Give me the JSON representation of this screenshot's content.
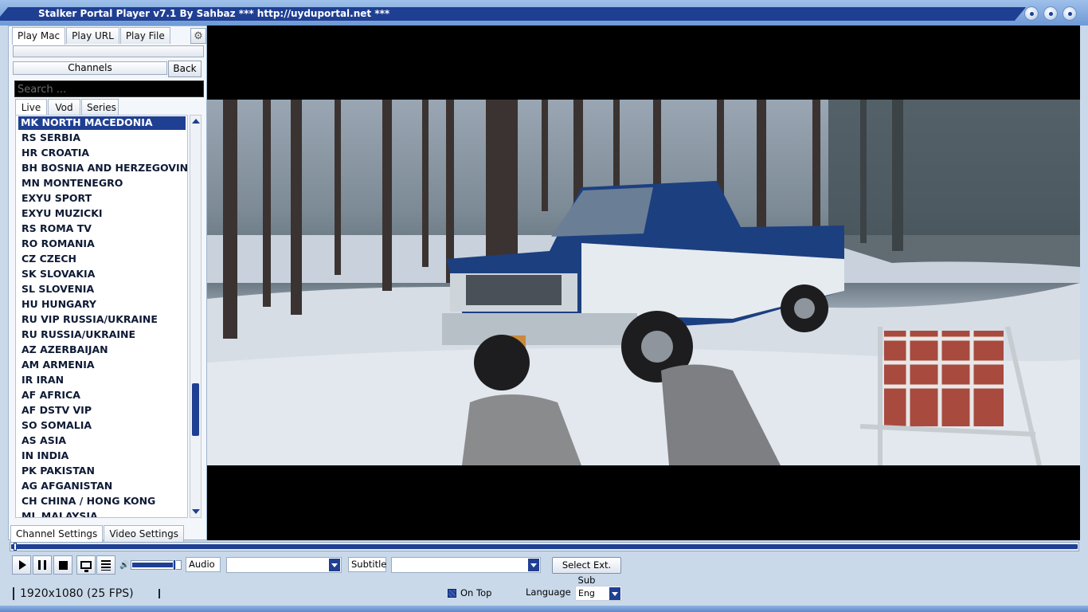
{
  "window": {
    "title": "Stalker Portal Player v7.1 By Sahbaz  *** http://uyduportal.net ***"
  },
  "left_panel": {
    "top_tabs": [
      "Play Mac",
      "Play URL",
      "Play File"
    ],
    "channels_label": "Channels",
    "back_label": "Back",
    "search_placeholder": "Search ...",
    "sub_tabs": [
      "Live",
      "Vod",
      "Series"
    ],
    "channels": [
      "MK NORTH MACEDONIA",
      "RS SERBIA",
      "HR CROATIA",
      "BH BOSNIA AND HERZEGOVINA",
      "MN MONTENEGRO",
      "EXYU SPORT",
      "EXYU MUZICKI",
      "RS ROMA TV",
      "RO ROMANIA",
      "CZ CZECH",
      "SK SLOVAKIA",
      "SL SLOVENIA",
      "HU HUNGARY",
      "RU VIP RUSSIA/UKRAINE",
      "RU RUSSIA/UKRAINE",
      "AZ AZERBAIJAN",
      "AM ARMENIA",
      "IR IRAN",
      "AF AFRICA",
      "AF DSTV VIP",
      "SO SOMALIA",
      "AS ASIA",
      "IN INDIA",
      "PK PAKISTAN",
      "AG AFGANISTAN",
      "CH CHINA / HONG KONG",
      "ML MALAYSIA"
    ],
    "selected_channel": "MK NORTH MACEDONIA",
    "bottom_tabs": [
      "Channel Settings",
      "Video Settings"
    ]
  },
  "controls": {
    "audio_label": "Audio",
    "audio_value": "",
    "subtitle_label": "Subtitle",
    "subtitle_value": "",
    "select_ext_sub_label": "Select Ext. Sub",
    "volume_level": 0.9,
    "seek_progress": 0.003
  },
  "status": {
    "resolution_text": "1920x1080  (25 FPS)",
    "on_top_label": "On Top",
    "on_top_checked": true,
    "language_label": "Language",
    "language_value": "Eng"
  },
  "colors": {
    "accent": "#1f3f93",
    "panel_bg": "#f3f6fa",
    "video_bg": "#000000"
  },
  "icons": {
    "play": "play-icon",
    "pause": "pause-icon",
    "stop": "stop-icon",
    "screen": "monitor-icon",
    "playlist": "list-icon",
    "volume": "speaker-icon",
    "settings": "gear-icon"
  }
}
